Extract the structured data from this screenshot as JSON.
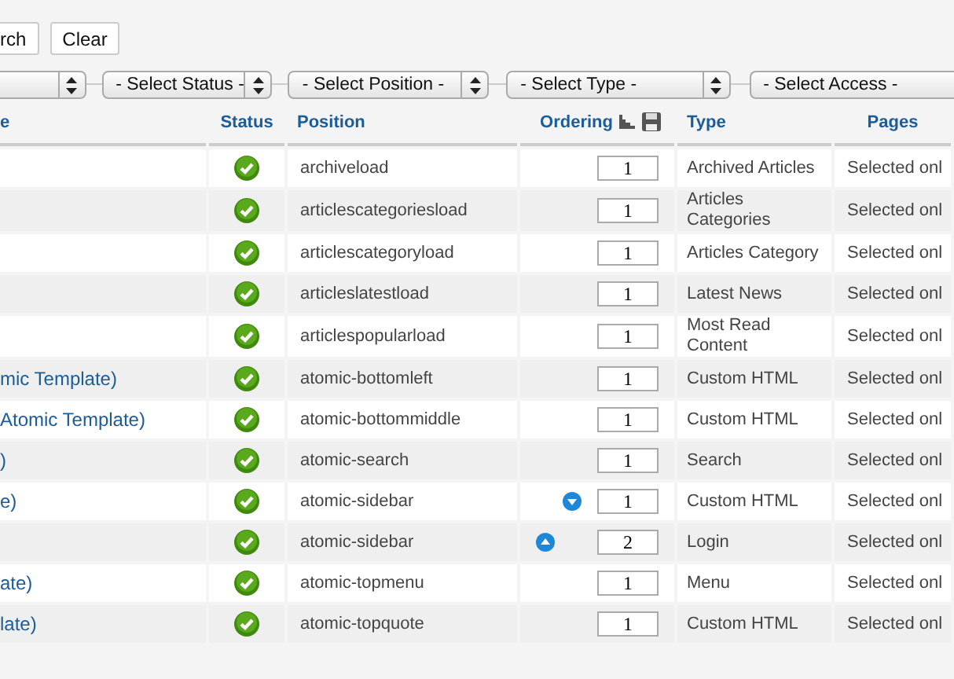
{
  "toolbar": {
    "buttons": [
      "rch",
      "Clear"
    ]
  },
  "filters": [
    {
      "arrow": true
    },
    {
      "label": "- Select Status -",
      "arrow": true
    },
    {
      "label": "- Select Position -",
      "arrow": true
    },
    {
      "label": "- Select Type -",
      "arrow": true
    },
    {
      "label": "- Select Access -",
      "arrow": false
    }
  ],
  "table": {
    "columns": [
      "e",
      "Status",
      "Position",
      "Ordering",
      "Type",
      "Pages"
    ],
    "rows": [
      {
        "published": true,
        "position": "archiveload",
        "order": "1",
        "can_move_up": false,
        "can_move_down": false,
        "type": "Archived Articles",
        "pages": "Selected onl"
      },
      {
        "published": true,
        "position": "articlescategoriesload",
        "order": "1",
        "can_move_up": false,
        "can_move_down": false,
        "type": "Articles\nCategories",
        "pages": "Selected onl"
      },
      {
        "published": true,
        "position": "articlescategoryload",
        "order": "1",
        "can_move_up": false,
        "can_move_down": false,
        "type": "Articles Category",
        "pages": "Selected onl"
      },
      {
        "published": true,
        "position": "articleslatestload",
        "order": "1",
        "can_move_up": false,
        "can_move_down": false,
        "type": "Latest News",
        "pages": "Selected onl"
      },
      {
        "published": true,
        "position": "articlespopularload",
        "order": "1",
        "can_move_up": false,
        "can_move_down": false,
        "type": "Most Read\nContent",
        "pages": "Selected onl"
      },
      {
        "title": "mic Template)",
        "published": true,
        "position": "atomic-bottomleft",
        "order": "1",
        "can_move_up": false,
        "can_move_down": false,
        "type": "Custom HTML",
        "pages": "Selected onl"
      },
      {
        "title": "Atomic Template)",
        "published": true,
        "position": "atomic-bottommiddle",
        "order": "1",
        "can_move_up": false,
        "can_move_down": false,
        "type": "Custom HTML",
        "pages": "Selected onl"
      },
      {
        "title": ")",
        "published": true,
        "position": "atomic-search",
        "order": "1",
        "can_move_up": false,
        "can_move_down": false,
        "type": "Search",
        "pages": "Selected onl"
      },
      {
        "title": "e)",
        "published": true,
        "position": "atomic-sidebar",
        "order": "1",
        "can_move_up": false,
        "can_move_down": true,
        "type": "Custom HTML",
        "pages": "Selected onl"
      },
      {
        "published": true,
        "position": "atomic-sidebar",
        "order": "2",
        "can_move_up": true,
        "can_move_down": false,
        "type": "Login",
        "pages": "Selected onl"
      },
      {
        "title": "ate)",
        "published": true,
        "position": "atomic-topmenu",
        "order": "1",
        "can_move_up": false,
        "can_move_down": false,
        "type": "Menu",
        "pages": "Selected onl"
      },
      {
        "title": "late)",
        "published": true,
        "position": "atomic-topquote",
        "order": "1",
        "can_move_up": false,
        "can_move_down": false,
        "type": "Custom HTML",
        "pages": "Selected onl"
      }
    ]
  }
}
